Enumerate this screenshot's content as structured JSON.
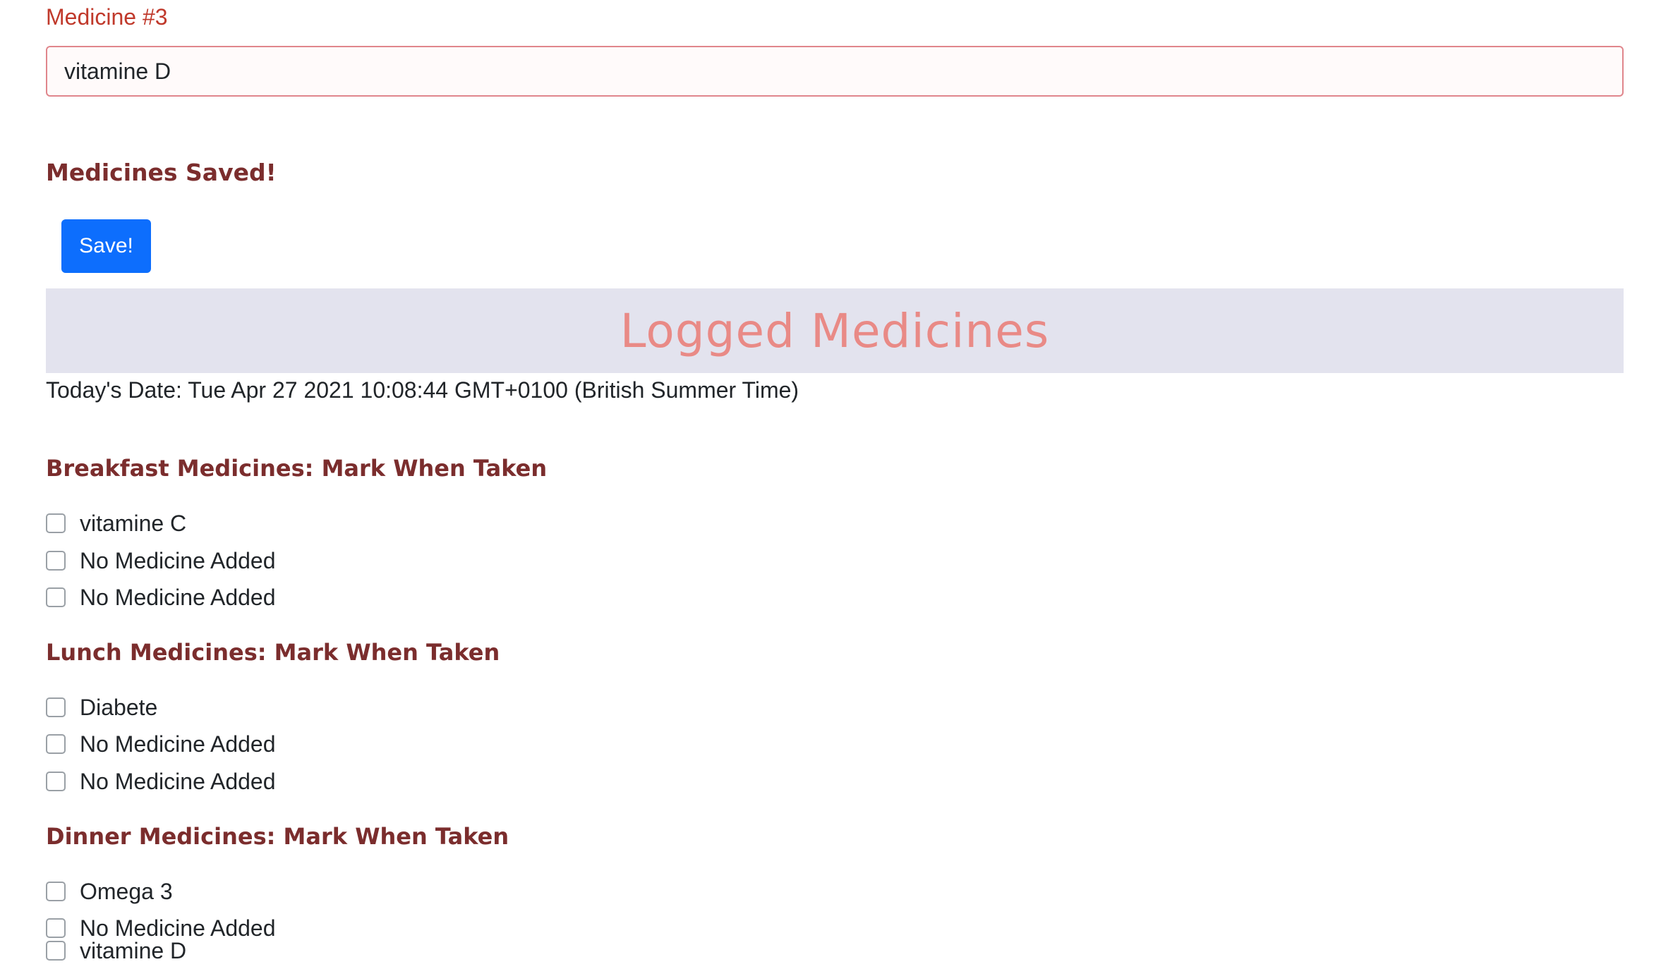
{
  "medicine_field": {
    "label": "Medicine #3",
    "value": "vitamine D"
  },
  "status_message": "Medicines Saved!",
  "save_button_label": "Save!",
  "logged_section": {
    "title": "Logged Medicines",
    "date_text": "Today's Date: Tue Apr 27 2021 10:08:44 GMT+0100 (British Summer Time)"
  },
  "meals": [
    {
      "heading": "Breakfast Medicines: Mark When Taken",
      "items": [
        {
          "label": "vitamine C",
          "checked": false
        },
        {
          "label": "No Medicine Added",
          "checked": false
        },
        {
          "label": "No Medicine Added",
          "checked": false
        }
      ]
    },
    {
      "heading": "Lunch Medicines: Mark When Taken",
      "items": [
        {
          "label": "Diabete",
          "checked": false
        },
        {
          "label": "No Medicine Added",
          "checked": false
        },
        {
          "label": "No Medicine Added",
          "checked": false
        }
      ]
    },
    {
      "heading": "Dinner Medicines: Mark When Taken",
      "items": [
        {
          "label": "Omega 3",
          "checked": false
        },
        {
          "label": "No Medicine Added",
          "checked": false
        },
        {
          "label": "vitamine D",
          "checked": false
        }
      ]
    }
  ]
}
